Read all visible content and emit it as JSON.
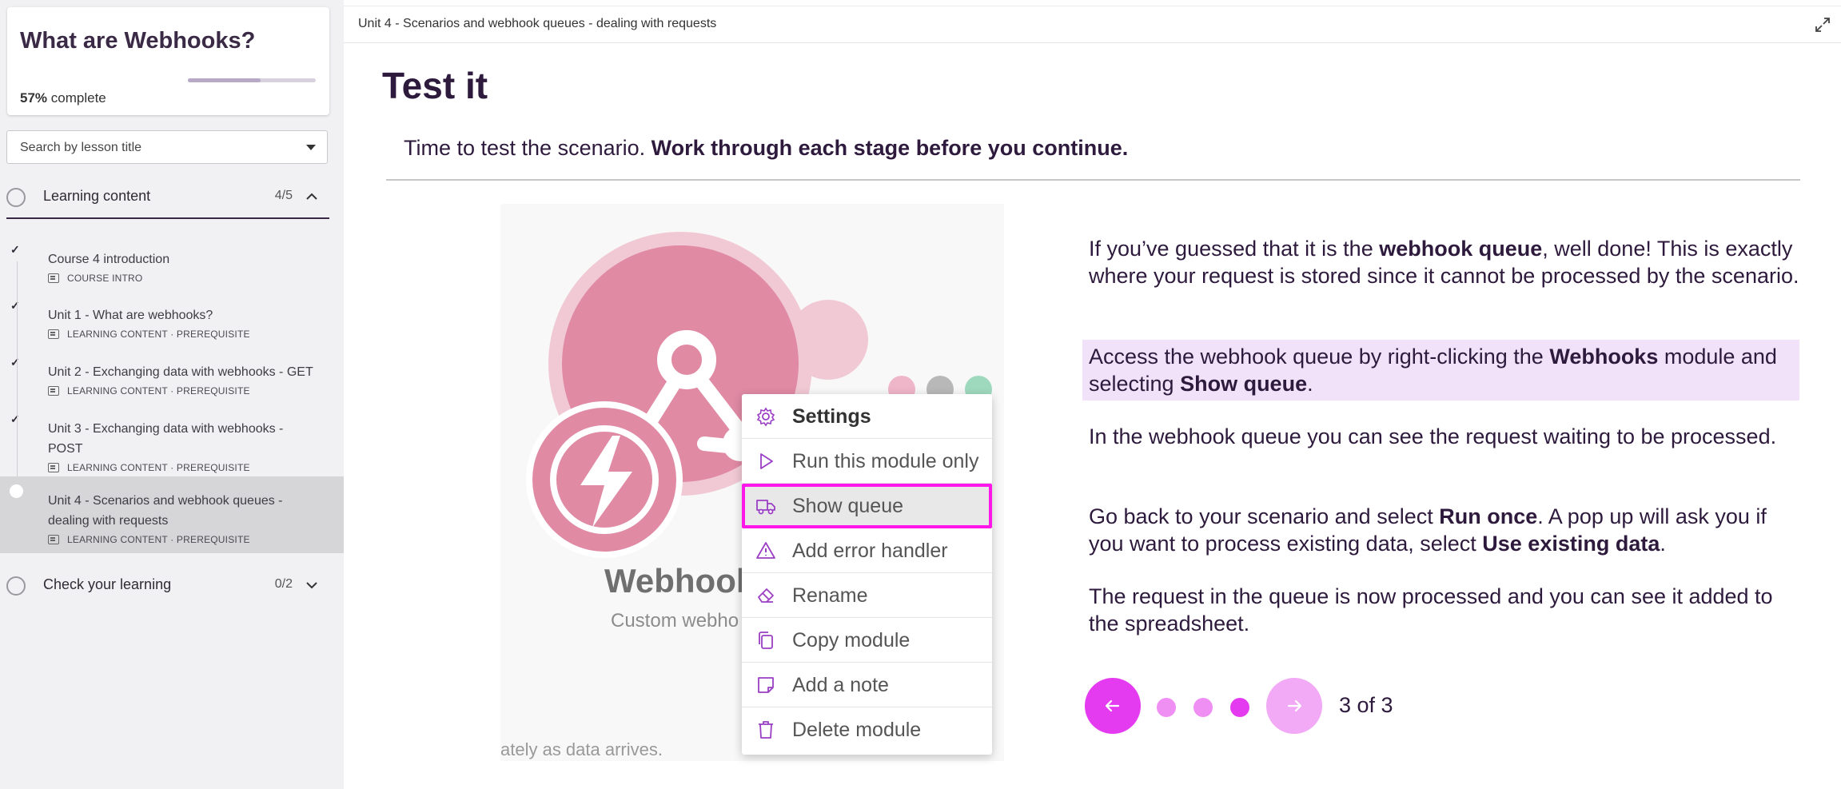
{
  "course": {
    "title": "What are Webhooks?",
    "progress_percent": "57%",
    "progress_suffix": "complete",
    "progress_fraction": 0.57
  },
  "search": {
    "placeholder": "Search by lesson title"
  },
  "sections": [
    {
      "title": "Learning content",
      "count": "4/5"
    },
    {
      "title": "Check your learning",
      "count": "0/2"
    }
  ],
  "lessons": [
    {
      "title": "Course 4 introduction",
      "meta": "COURSE INTRO",
      "done": true
    },
    {
      "title": "Unit 1 - What are webhooks?",
      "meta": "LEARNING CONTENT · PREREQUISITE",
      "done": true
    },
    {
      "title": "Unit 2 - Exchanging data with webhooks - GET",
      "meta": "LEARNING CONTENT · PREREQUISITE",
      "done": true
    },
    {
      "title": "Unit 3 - Exchanging data with webhooks - POST",
      "meta": "LEARNING CONTENT · PREREQUISITE",
      "done": true
    },
    {
      "title": "Unit 4 - Scenarios and webhook queues - dealing with requests",
      "meta": "LEARNING CONTENT · PREREQUISITE",
      "done": false,
      "active": true
    }
  ],
  "header": {
    "breadcrumb": "Unit 4 - Scenarios and webhook queues - dealing with requests"
  },
  "lesson": {
    "title": "Test it",
    "intro_plain": "Time to test the scenario. ",
    "intro_bold": "Work through each stage before you continue."
  },
  "image": {
    "module_name": "Webhool",
    "module_sub": "Custom webho",
    "caption": "ately as data arrives.",
    "menu": [
      {
        "label": "Settings",
        "icon": "gear-icon",
        "bold": true
      },
      {
        "label": "Run this module only",
        "icon": "play-icon"
      },
      {
        "label": "Show queue",
        "icon": "truck-icon",
        "highlight": true
      },
      {
        "label": "Add error handler",
        "icon": "warning-icon"
      },
      {
        "label": "Rename",
        "icon": "eraser-icon"
      },
      {
        "label": "Copy module",
        "icon": "copy-icon"
      },
      {
        "label": "Add a note",
        "icon": "note-icon"
      },
      {
        "label": "Delete module",
        "icon": "trash-icon"
      }
    ]
  },
  "content": {
    "p1": [
      "If you’ve guessed that it is the ",
      "webhook queue",
      ", well done! This is exactly where your request is stored since it cannot be processed by the scenario."
    ],
    "p2": [
      "Access the webhook queue by right-clicking the ",
      "Webhooks",
      " module and selecting ",
      "Show queue",
      "."
    ],
    "p3": "In the webhook queue you can see the request waiting to be processed.",
    "p4": [
      "Go back to your scenario and select ",
      "Run once",
      ". A pop up will ask you if you want to process existing data, select ",
      "Use existing data",
      "."
    ],
    "p5": "The request in the queue is now processed and you can see it added to the spreadsheet."
  },
  "pager": {
    "text": "3 of 3",
    "current": 3,
    "total": 3
  },
  "colors": {
    "accent": "#e53bf0",
    "accent_light": "#f2a9f6",
    "highlight_border": "#ff16e8",
    "text": "#2d1a3c"
  }
}
